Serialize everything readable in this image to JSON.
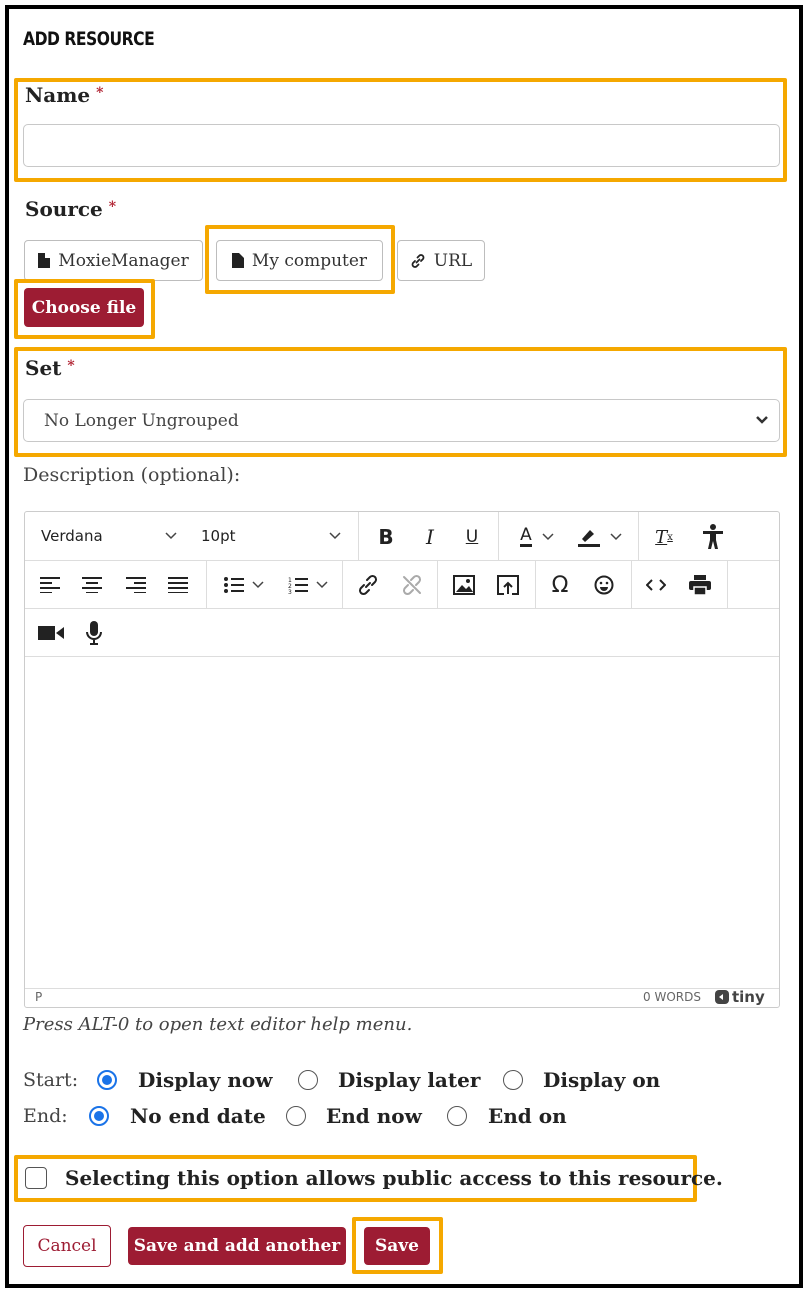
{
  "title": "ADD RESOURCE",
  "name_field": {
    "label": "Name",
    "required_mark": "*",
    "value": ""
  },
  "source": {
    "label": "Source",
    "required_mark": "*",
    "options": [
      {
        "label": "MoxieManager",
        "icon": "file-icon"
      },
      {
        "label": "My computer",
        "icon": "file-icon"
      },
      {
        "label": "URL",
        "icon": "link-icon"
      }
    ],
    "choose_file_label": "Choose file"
  },
  "set_field": {
    "label": "Set",
    "required_mark": "*",
    "selected": "No Longer Ungrouped"
  },
  "description": {
    "label": "Description (optional):",
    "font": "Verdana",
    "size": "10pt",
    "status_path": "P",
    "word_count": "0 WORDS",
    "brand": "tiny",
    "help_text": "Press ALT-0 to open text editor help menu."
  },
  "toolbar_icons": [
    "bold-icon",
    "italic-icon",
    "underline-icon",
    "text-color-icon",
    "highlight-icon",
    "clear-format-icon",
    "accessibility-icon",
    "align-left-icon",
    "align-center-icon",
    "align-right-icon",
    "justify-icon",
    "bullet-list-icon",
    "numbered-list-icon",
    "link-icon",
    "unlink-icon",
    "image-icon",
    "upload-icon",
    "special-char-icon",
    "emoji-icon",
    "code-icon",
    "print-icon",
    "video-icon",
    "mic-icon"
  ],
  "start": {
    "label": "Start:",
    "options": [
      "Display now",
      "Display later",
      "Display on"
    ],
    "selected": 0
  },
  "end": {
    "label": "End:",
    "options": [
      "No end date",
      "End now",
      "End on"
    ],
    "selected": 0
  },
  "public_access": {
    "label": "Selecting this option allows public access to this resource.",
    "checked": false
  },
  "actions": {
    "cancel": "Cancel",
    "save_add": "Save and add another",
    "save": "Save"
  },
  "colors": {
    "accent": "#9d1c33",
    "highlight": "#f5a800",
    "radio": "#1a73e8"
  }
}
